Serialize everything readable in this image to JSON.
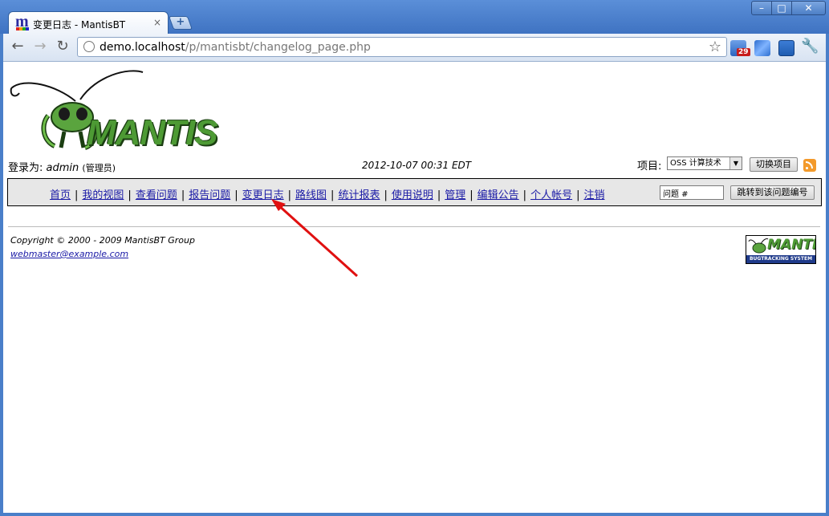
{
  "browser": {
    "tab_title": "变更日志 - MantisBT",
    "tab_close": "×",
    "new_tab": "+",
    "url_host": "demo.localhost",
    "url_path": "/p/mantisbt/changelog_page.php",
    "extension_badge": "29"
  },
  "header": {
    "logo_text": "MANTIS",
    "login_label": "登录为:",
    "username": "admin",
    "role": "(管理员)",
    "datetime": "2012-10-07 00:31 EDT",
    "project_label": "项目:",
    "project_selected": "OSS 计算技术",
    "switch_button": "切换项目"
  },
  "menu": {
    "items": [
      "首页",
      "我的视图",
      "查看问题",
      "报告问题",
      "变更日志",
      "路线图",
      "统计报表",
      "使用说明",
      "管理",
      "编辑公告",
      "个人帐号",
      "注销"
    ],
    "separator": "|",
    "jump_placeholder": "问题 #",
    "jump_button": "跳转到该问题编号"
  },
  "footer": {
    "copyright": "Copyright © 2000 - 2009 MantisBT Group",
    "email": "webmaster@example.com",
    "powered_logo": "MANTIS",
    "powered_subtitle": "BUGTRACKING SYSTEM"
  },
  "colors": {
    "link": "#1a1aa6",
    "menu_bg": "#e7e7e7",
    "annotation_arrow": "#e01010"
  }
}
